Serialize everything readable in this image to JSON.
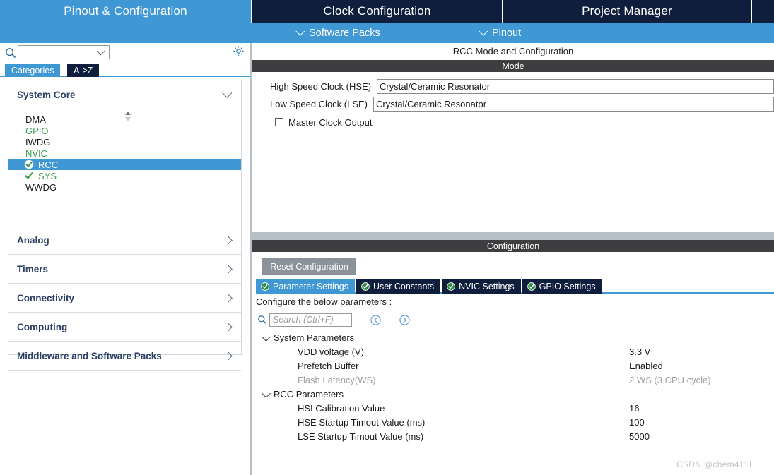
{
  "main_tabs": [
    {
      "label": "Pinout & Configuration",
      "active": true
    },
    {
      "label": "Clock Configuration",
      "active": false
    },
    {
      "label": "Project Manager",
      "active": false
    },
    {
      "label": "",
      "active": false
    }
  ],
  "sub_bar": {
    "software_packs": "Software Packs",
    "pinout": "Pinout"
  },
  "left_panel": {
    "search": {
      "value": "",
      "placeholder": ""
    },
    "gear_icon": "gear-icon",
    "search_icon": "search-icon",
    "view_tabs": [
      {
        "label": "Categories",
        "active": true
      },
      {
        "label": "A->Z",
        "active": false
      }
    ],
    "groups": [
      {
        "label": "System Core",
        "expanded": true
      },
      {
        "label": "Analog",
        "expanded": false
      },
      {
        "label": "Timers",
        "expanded": false
      },
      {
        "label": "Connectivity",
        "expanded": false
      },
      {
        "label": "Computing",
        "expanded": false
      },
      {
        "label": "Middleware and Software Packs",
        "expanded": false
      }
    ],
    "system_core_items": [
      {
        "label": "DMA",
        "state": "plain",
        "selected": false
      },
      {
        "label": "GPIO",
        "state": "green",
        "selected": false
      },
      {
        "label": "IWDG",
        "state": "plain",
        "selected": false
      },
      {
        "label": "NVIC",
        "state": "green",
        "selected": false
      },
      {
        "label": "RCC",
        "state": "checked",
        "selected": true
      },
      {
        "label": "SYS",
        "state": "checked",
        "selected": false
      },
      {
        "label": "WWDG",
        "state": "plain",
        "selected": false
      }
    ]
  },
  "right_panel": {
    "title": "RCC Mode and Configuration",
    "mode_header": "Mode",
    "mode_rows": [
      {
        "label": "High Speed Clock (HSE)",
        "value": "Crystal/Ceramic Resonator"
      },
      {
        "label": "Low Speed Clock (LSE)",
        "value": "Crystal/Ceramic Resonator"
      }
    ],
    "master_clock_output": {
      "label": "Master Clock Output",
      "checked": false
    },
    "configuration_header": "Configuration",
    "reset_button": "Reset Configuration",
    "config_tabs": [
      {
        "label": "Parameter Settings",
        "active": true
      },
      {
        "label": "User Constants",
        "active": false
      },
      {
        "label": "NVIC Settings",
        "active": false
      },
      {
        "label": "GPIO Settings",
        "active": false
      }
    ],
    "configure_note": "Configure the below parameters :",
    "param_search": {
      "value": "",
      "placeholder": "Search (Ctrl+F)"
    },
    "nav_prev_icon": "chevron-left-circle-icon",
    "nav_next_icon": "chevron-right-circle-icon",
    "parameter_groups": [
      {
        "label": "System Parameters",
        "expanded": true,
        "rows": [
          {
            "name": "VDD voltage (V)",
            "value": "3.3 V",
            "dimmed": false
          },
          {
            "name": "Prefetch Buffer",
            "value": "Enabled",
            "dimmed": false
          },
          {
            "name": "Flash Latency(WS)",
            "value": "2 WS (3 CPU cycle)",
            "dimmed": true
          }
        ]
      },
      {
        "label": "RCC Parameters",
        "expanded": true,
        "rows": [
          {
            "name": "HSI Calibration Value",
            "value": "16",
            "dimmed": false
          },
          {
            "name": "HSE Startup Timout Value (ms)",
            "value": "100",
            "dimmed": false
          },
          {
            "name": "LSE Startup Timout Value (ms)",
            "value": "5000",
            "dimmed": false
          }
        ]
      }
    ]
  },
  "watermark": "CSDN @chem4111",
  "colors": {
    "accent_blue": "#3f97d3",
    "dark_navy": "#0f1e3d",
    "header_bar": "#3e3e40",
    "green_check": "#3f9c52",
    "reset_gray": "#8c9299"
  }
}
